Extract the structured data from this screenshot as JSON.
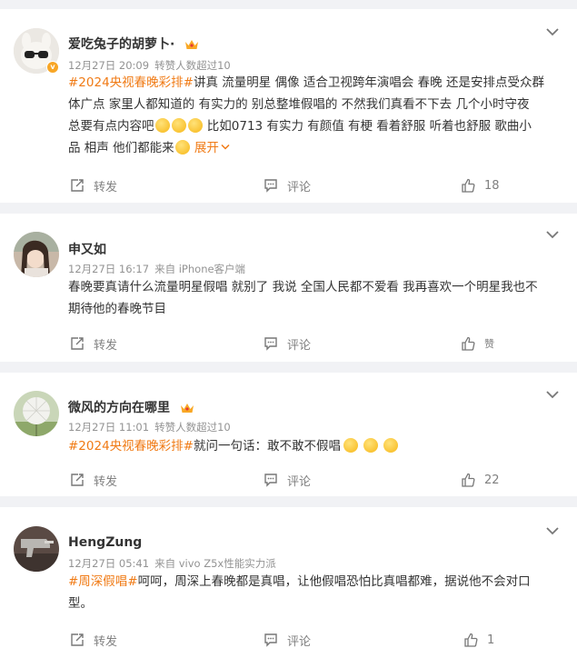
{
  "posts": [
    {
      "username": "爱吃兔子的胡萝卜·",
      "time": "12月27日 20:09",
      "source": "转赞人数超过10",
      "has_crown": true,
      "has_vip": true,
      "body_tag": "#2024央视春晚彩排#",
      "body_line1": "讲真 流量明星 偶像 适合卫视跨年演唱会 春晚 还是安排点受众群",
      "body_line2": "体广点 家里人都知道的 有实力的 别总整堆假唱的 不然我们真看不下去 几个小时守夜",
      "body_line3": "总要有点内容吧",
      "body_line3b": " 比如0713 有实力 有颜值 有梗 看着舒服 听着也舒服 歌曲小",
      "body_line4": "品 相声 他们都能来",
      "expand_label": "展开",
      "repost_label": "转发",
      "comment_label": "评论",
      "like_count": "18"
    },
    {
      "username": "申又如",
      "time": "12月27日 16:17",
      "source": "来自 iPhone客户端",
      "body_line1": "春晚要真请什么流量明星假唱 就别了 我说 全国人民都不爱看 我再喜欢一个明星我也不",
      "body_line2": "期待他的春晚节目",
      "repost_label": "转发",
      "comment_label": "评论",
      "like_count": "赞"
    },
    {
      "username": "微风的方向在哪里",
      "time": "12月27日 11:01",
      "source": "转赞人数超过10",
      "has_crown": true,
      "body_tag": "#2024央视春晚彩排#",
      "body_line1": "就问一句话：敢不敢不假唱",
      "repost_label": "转发",
      "comment_label": "评论",
      "like_count": "22"
    },
    {
      "username": "HengZung",
      "time": "12月27日 05:41",
      "source": "来自 vivo Z5x性能实力派",
      "body_tag": "#周深假唱#",
      "body_line1": "呵呵，周深上春晚都是真唱，让他假唱恐怕比真唱都难，据说他不会对口",
      "body_line2": "型。",
      "repost_label": "转发",
      "comment_label": "评论",
      "like_count": "1"
    }
  ],
  "colors": {
    "accent": "#f07a14",
    "background": "#f1f2f5",
    "meta_text": "#939393"
  }
}
